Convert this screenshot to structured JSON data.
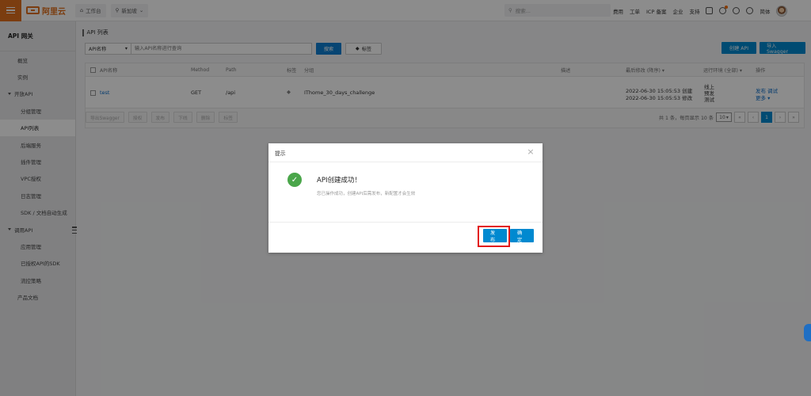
{
  "topbar": {
    "logo_text": "阿里云",
    "workbench": "工作台",
    "region": "新加坡",
    "search_placeholder": "搜索...",
    "links": [
      "费用",
      "工单",
      "ICP 备案",
      "企业",
      "支持"
    ],
    "lang": "简体"
  },
  "sidebar": {
    "title": "API 网关",
    "items": [
      {
        "label": "概览",
        "level": "l1"
      },
      {
        "label": "实例",
        "level": "l1"
      },
      {
        "label": "开放API",
        "level": "group"
      },
      {
        "label": "分组管理",
        "level": "l2"
      },
      {
        "label": "API列表",
        "level": "l2",
        "active": true
      },
      {
        "label": "后端服务",
        "level": "l2"
      },
      {
        "label": "插件管理",
        "level": "l2"
      },
      {
        "label": "VPC授权",
        "level": "l2"
      },
      {
        "label": "日志管理",
        "level": "l2"
      },
      {
        "label": "SDK / 文档自动生成",
        "level": "l2"
      },
      {
        "label": "调用API",
        "level": "group"
      },
      {
        "label": "应用管理",
        "level": "l2"
      },
      {
        "label": "已授权API的SDK",
        "level": "l2"
      },
      {
        "label": "流控策略",
        "level": "l2"
      },
      {
        "label": "产品文档",
        "level": "l1"
      }
    ]
  },
  "main": {
    "page_title": "API 列表",
    "filter": {
      "select_value": "API名称",
      "input_placeholder": "输入API名称进行查询",
      "search_label": "搜索",
      "tag_label": "标签"
    },
    "create_api": "创建 API",
    "import_swagger": "导入 Swagger",
    "columns": {
      "name": "API名称",
      "method": "Method",
      "path": "Path",
      "tag": "标签",
      "group": "分组",
      "desc": "描述",
      "modified": "最后修改 (降序) ▾",
      "env": "运行环境 (全部) ▾",
      "ops": "操作"
    },
    "row": {
      "name": "test",
      "method": "GET",
      "path": "/api",
      "group": "IThome_30_days_challenge",
      "created": "2022-06-30 15:05:53 创建",
      "modified": "2022-06-30 15:05:53 修改",
      "env": [
        "线上",
        "预发",
        "测试"
      ],
      "publish": "发布",
      "debug": "调试",
      "more": "更多 ▾"
    },
    "bulk": [
      "导出Swagger",
      "授权",
      "发布",
      "下线",
      "删除",
      "标签"
    ],
    "pager": {
      "summary": "共 1 条，每页显示 10 条",
      "page_size": "10",
      "current_page": "1",
      "prev_prev": "«",
      "prev": "‹",
      "next": "›",
      "next_next": "»"
    }
  },
  "modal": {
    "header": "提示",
    "close": "×",
    "title": "API创建成功！",
    "desc": "您已操作成功，创建API后需发布，新配置才会生效",
    "publish_label": "发布",
    "ok_label": "确定"
  },
  "colors": {
    "accent": "#0089d0",
    "brand": "#e0701e",
    "success": "#4aa64a",
    "highlight": "#e21818"
  }
}
